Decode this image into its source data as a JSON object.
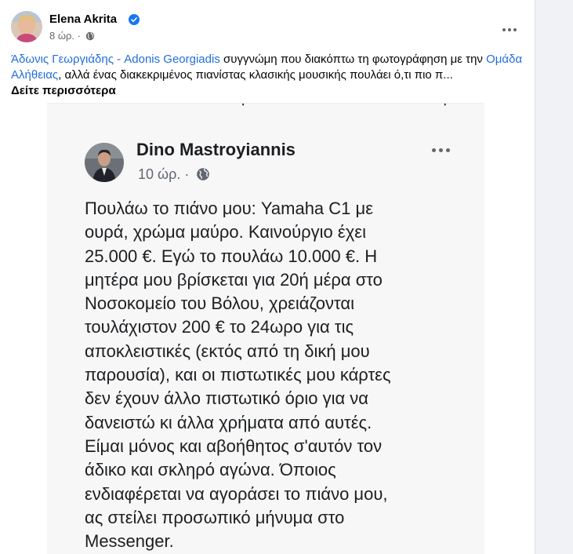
{
  "post": {
    "author": "Elena Akrita",
    "verified_icon": "verified-badge-icon",
    "time": "8 ώρ. ·",
    "privacy_icon": "globe-icon",
    "caption": {
      "mention_1": "Άδωνις Γεωργιάδης - Adonis Georgiadis",
      "text_1": " συγγνώμη που διακόπτω τη φωτογράφηση με την ",
      "mention_2": "Ομάδα Αλήθειας",
      "text_2": ", αλλά ένας διακεκριμένος πιανίστας κλασικής μουσικής πουλάει ό,τι πιο π...",
      "see_more": "Δείτε περισσότερα"
    }
  },
  "shared_image": {
    "author": "Dino Mastroyiannis",
    "time": "10 ώρ. ·",
    "lines": [
      "Πουλάω το πιάνο μου: Yamaha C1 με",
      "ουρά, χρώμα μαύρο. Καινούργιο έχει",
      "25.000 €. Εγώ το πουλάω 10.000 €.  Η",
      "μητέρα μου βρίσκεται για 20ή μέρα στο",
      "Νοσοκομείο του Βόλου, χρειάζονται",
      "τουλάχιστον 200 € το 24ωρο για τις",
      "αποκλειστικές (εκτός από τη δική μου",
      "παρουσία), και οι πιστωτικές μου κάρτες",
      "δεν έχουν άλλο πιστωτικό όριο για να",
      "δανειστώ κι άλλα χρήματα από αυτές.",
      "Είμαι μόνος και αβοήθητος σ'αυτόν τον",
      "άδικο και σκληρό αγώνα. Όποιος",
      "ενδιαφέρεται να αγοράσει το πιάνο μου,",
      "ας στείλει προσωπικό μήνυμα στο",
      "Messenger."
    ]
  },
  "colors": {
    "link": "#216fdb",
    "verified": "#1877f2"
  }
}
